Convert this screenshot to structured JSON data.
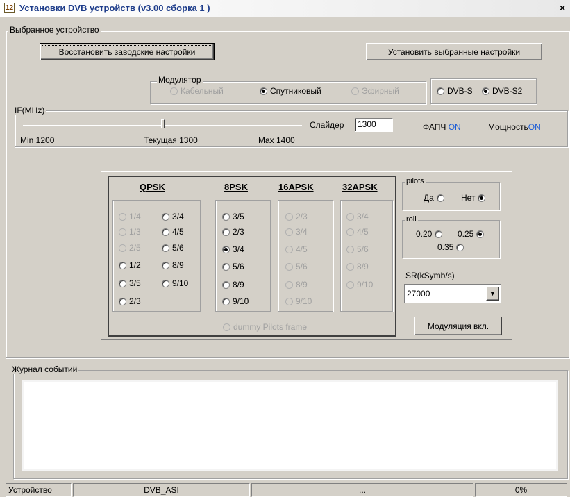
{
  "window": {
    "title": "Установки DVB устройств (v3.00 сборка 1 )",
    "icon_glyph": "12",
    "close_glyph": "×"
  },
  "device_group": {
    "label": "Выбранное устройство",
    "restore_button": "Восстановить заводские настройки",
    "apply_button": "Установить выбранные настройки",
    "modulator": {
      "label": "Модулятор",
      "options": [
        {
          "label": "Кабельный",
          "selected": false,
          "enabled": false
        },
        {
          "label": "Спутниковый",
          "selected": true,
          "enabled": true
        },
        {
          "label": "Эфирный",
          "selected": false,
          "enabled": false
        }
      ]
    },
    "standard": {
      "options": [
        {
          "label": "DVB-S",
          "selected": false
        },
        {
          "label": "DVB-S2",
          "selected": true
        }
      ]
    }
  },
  "if_group": {
    "label": "IF(MHz)",
    "slider_label": "Слайдер",
    "slider_value": "1300",
    "slider_min": 1200,
    "slider_max": 1400,
    "slider_current": 1300,
    "min_text": "Min 1200",
    "current_text": "Текущая 1300",
    "max_text": "Max 1400",
    "pll_label": "ФАПЧ",
    "pll_state": "ON",
    "power_label": "Мощность",
    "power_state": "ON"
  },
  "modulation": {
    "qpsk": {
      "header": "QPSK",
      "col1": [
        "1/4",
        "1/3",
        "2/5",
        "1/2",
        "3/5",
        "2/3"
      ],
      "col1_enabled": [
        false,
        false,
        false,
        true,
        true,
        true
      ],
      "col2": [
        "3/4",
        "4/5",
        "5/6",
        "8/9",
        "9/10"
      ]
    },
    "psk8": {
      "header": "8PSK",
      "items": [
        "3/5",
        "2/3",
        "3/4",
        "5/6",
        "8/9",
        "9/10"
      ],
      "selected": "3/4"
    },
    "apsk16": {
      "header": "16APSK",
      "items": [
        "2/3",
        "3/4",
        "4/5",
        "5/6",
        "8/9",
        "9/10"
      ]
    },
    "apsk32": {
      "header": "32APSK",
      "items": [
        "3/4",
        "4/5",
        "5/6",
        "8/9",
        "9/10"
      ]
    },
    "dummy_label": "dummy Pilots frame",
    "pilots": {
      "label": "pilots",
      "yes": "Да",
      "no": "Нет",
      "selected": "Нет"
    },
    "roll": {
      "label": "roll",
      "options": [
        "0.20",
        "0.25",
        "0.35"
      ],
      "selected": "0.25"
    },
    "sr": {
      "label": "SR(kSymb/s)",
      "value": "27000"
    },
    "modulation_button": "Модуляция вкл."
  },
  "log": {
    "label": "Журнал событий"
  },
  "status": {
    "device_label": "Устройство",
    "device_value": "DVB_ASI",
    "middle": "...",
    "progress": "0%"
  }
}
